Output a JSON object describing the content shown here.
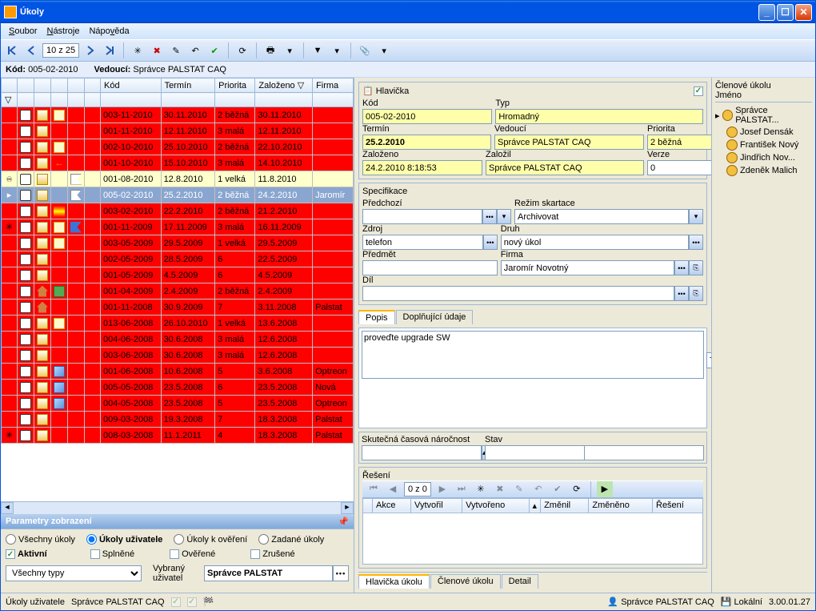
{
  "title": "Úkoly",
  "menu": {
    "soubor": "Soubor",
    "nastroje": "Nástroje",
    "napoveda": "Nápověda"
  },
  "pager": "10 z 25",
  "info": {
    "kod_label": "Kód:",
    "kod_val": "005-02-2010",
    "vedouci_label": "Vedoucí:",
    "vedouci_val": "Správce PALSTAT CAQ"
  },
  "grid": {
    "headers": {
      "kod": "Kód",
      "termin": "Termín",
      "priorita": "Priorita",
      "zalozeno": "Založeno",
      "firma": "Firma"
    },
    "rows": [
      {
        "kod": "003-11-2010",
        "termin": "30.11.2010",
        "pri": "2 běžná",
        "zal": "30.11.2010",
        "firma": "",
        "cls": "red",
        "env": true,
        "note": true,
        "flag": "r"
      },
      {
        "kod": "001-11-2010",
        "termin": "12.11.2010",
        "pri": "3 malá",
        "zal": "12.11.2010",
        "firma": "",
        "cls": "red",
        "env": true,
        "flag": "r"
      },
      {
        "kod": "002-10-2010",
        "termin": "25.10.2010",
        "pri": "2 běžná",
        "zal": "22.10.2010",
        "firma": "",
        "cls": "red",
        "env": true,
        "note": true,
        "flag": "r"
      },
      {
        "kod": "001-10-2010",
        "termin": "15.10.2010",
        "pri": "3 malá",
        "zal": "14.10.2010",
        "firma": "",
        "cls": "red",
        "env": true,
        "flag": "r",
        "arrow": true
      },
      {
        "kod": "001-08-2010",
        "termin": "12.8.2010",
        "pri": "1 velká",
        "zal": "11.8.2010",
        "firma": "",
        "cls": "yellow",
        "env": true,
        "flag": "w",
        "mark": "inf"
      },
      {
        "kod": "005-02-2010",
        "termin": "25.2.2010",
        "pri": "2 běžná",
        "zal": "24.2.2010",
        "firma": "Jaromír",
        "cls": "selected",
        "env": true,
        "flag": "w",
        "mark": "sel"
      },
      {
        "kod": "003-02-2010",
        "termin": "22.2.2010",
        "pri": "2 běžná",
        "zal": "21.2.2010",
        "firma": "",
        "cls": "red",
        "env": true,
        "flag": "r",
        "stripe": true
      },
      {
        "kod": "001-11-2009",
        "termin": "17.11.2009",
        "pri": "3 malá",
        "zal": "16.11.2009",
        "firma": "",
        "cls": "red",
        "env": true,
        "note": true,
        "flag": "b",
        "mark": "star"
      },
      {
        "kod": "003-05-2009",
        "termin": "29.5.2009",
        "pri": "1 velká",
        "zal": "29.5.2009",
        "firma": "",
        "cls": "red",
        "env": true,
        "note": true,
        "flag": "r"
      },
      {
        "kod": "002-05-2009",
        "termin": "28.5.2009",
        "pri": "6",
        "zal": "22.5.2009",
        "firma": "",
        "cls": "red",
        "env": true,
        "flag": "r"
      },
      {
        "kod": "001-05-2009",
        "termin": "4.5.2009",
        "pri": "6",
        "zal": "4.5.2009",
        "firma": "",
        "cls": "red",
        "env": true,
        "flag": "r"
      },
      {
        "kod": "001-04-2009",
        "termin": "2.4.2009",
        "pri": "2 běžná",
        "zal": "2.4.2009",
        "firma": "",
        "cls": "red",
        "home": true,
        "flag": "r",
        "tree": true
      },
      {
        "kod": "001-11-2008",
        "termin": "30.9.2009",
        "pri": "7",
        "zal": "3.11.2008",
        "firma": "Palstat",
        "cls": "red",
        "home": true,
        "flag": "r"
      },
      {
        "kod": "013-06-2008",
        "termin": "26.10.2010",
        "pri": "1 velká",
        "zal": "13.6.2008",
        "firma": "",
        "cls": "red",
        "env": true,
        "note": true,
        "flag": "r"
      },
      {
        "kod": "004-06-2008",
        "termin": "30.6.2008",
        "pri": "3 malá",
        "zal": "12.6.2008",
        "firma": "",
        "cls": "red",
        "env": true,
        "flag": "r"
      },
      {
        "kod": "003-06-2008",
        "termin": "30.6.2008",
        "pri": "3 malá",
        "zal": "12.6.2008",
        "firma": "",
        "cls": "red",
        "env": true,
        "flag": "r"
      },
      {
        "kod": "001-06-2008",
        "termin": "10.6.2008",
        "pri": "5",
        "zal": "3.6.2008",
        "firma": "Optreon",
        "cls": "red",
        "env": true,
        "cube": true,
        "flag": "r"
      },
      {
        "kod": "005-05-2008",
        "termin": "23.5.2008",
        "pri": "6",
        "zal": "23.5.2008",
        "firma": "Nová",
        "cls": "red",
        "env": true,
        "cube": true,
        "flag": "r"
      },
      {
        "kod": "004-05-2008",
        "termin": "23.5.2008",
        "pri": "5",
        "zal": "23.5.2008",
        "firma": "Optreon",
        "cls": "red",
        "env": true,
        "cube": true,
        "flag": "r"
      },
      {
        "kod": "009-03-2008",
        "termin": "19.3.2008",
        "pri": "7",
        "zal": "18.3.2008",
        "firma": "Palstat",
        "cls": "red",
        "env": true,
        "flag": "r"
      },
      {
        "kod": "008-03-2008",
        "termin": "11.1.2011",
        "pri": "4",
        "zal": "18.3.2008",
        "firma": "Palstat",
        "cls": "red",
        "env": true,
        "flag": "r",
        "mark": "star"
      }
    ]
  },
  "params": {
    "title": "Parametry zobrazení",
    "r1": {
      "vsechny": "Všechny úkoly",
      "uzivatele": "Úkoly uživatele",
      "overeni": "Úkoly k ověření",
      "zadane": "Zadané úkoly"
    },
    "r2": {
      "aktivni": "Aktivní",
      "splnene": "Splněné",
      "overene": "Ověřené",
      "zrusene": "Zrušené"
    },
    "r3": {
      "typy": "Všechny typy",
      "vybrany_lbl": "Vybraný uživatel",
      "vybrany_val": "Správce PALSTAT"
    }
  },
  "hdr": {
    "title": "Hlavička",
    "kod_l": "Kód",
    "kod_v": "005-02-2010",
    "typ_l": "Typ",
    "typ_v": "Hromadný",
    "termin_l": "Termín",
    "termin_v": "25.2.2010",
    "vedouci_l": "Vedoucí",
    "vedouci_v": "Správce PALSTAT CAQ",
    "priorita_l": "Priorita",
    "priorita_v": "2 běžná",
    "zalozeno_l": "Založeno",
    "zalozeno_v": "24.2.2010 8:18:53",
    "zalozil_l": "Založil",
    "zalozil_v": "Správce PALSTAT CAQ",
    "verze_l": "Verze",
    "verze_v": "0"
  },
  "spec": {
    "title": "Specifikace",
    "pred_l": "Předchozí",
    "rezim_l": "Režim skartace",
    "rezim_v": "Archivovat",
    "zdroj_l": "Zdroj",
    "zdroj_v": "telefon",
    "druh_l": "Druh",
    "druh_v": "nový úkol",
    "predmet_l": "Předmět",
    "firma_l": "Firma",
    "firma_v": "Jaromír Novotný",
    "dil_l": "Díl"
  },
  "desc": {
    "tab1": "Popis",
    "tab2": "Doplňující údaje",
    "text": "proveďte upgrade SW",
    "narocnost_l": "Skutečná časová náročnost",
    "stav_l": "Stav",
    "reseni_l": "Řešení",
    "pager": "0 z 0",
    "cols": {
      "akce": "Akce",
      "vytvoril": "Vytvořil",
      "vytvoreno": "Vytvořeno",
      "zmenil": "Změnil",
      "zmeneno": "Změněno",
      "reseni": "Řešení"
    }
  },
  "btabs": {
    "h": "Hlavička úkolu",
    "c": "Členové úkolu",
    "d": "Detail"
  },
  "members": {
    "title": "Členové úkolu",
    "col": "Jméno",
    "root": "Správce PALSTAT...",
    "nodes": [
      "Josef Densák",
      "František Nový",
      "Jindřich Nov...",
      "Zdeněk Malich"
    ]
  },
  "status": {
    "left1": "Úkoly uživatele",
    "left2": "Správce PALSTAT CAQ",
    "user": "Správce PALSTAT CAQ",
    "conn": "Lokální",
    "ver": "3.00.01.27"
  }
}
